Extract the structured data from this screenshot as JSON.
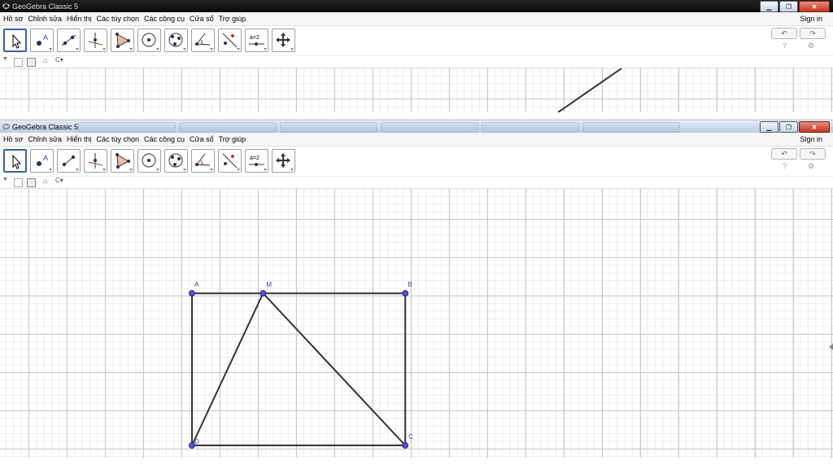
{
  "windows": [
    {
      "title": "GeoGebra Classic 5",
      "menu": [
        "Hồ sơ",
        "Chỉnh sửa",
        "Hiển thị",
        "Các tùy chọn",
        "Các công cụ",
        "Cửa sổ",
        "Trợ giúp"
      ],
      "sign_in": "Sign in"
    },
    {
      "title": "GeoGebra Classic 5",
      "menu": [
        "Hồ sơ",
        "Chỉnh sửa",
        "Hiển thị",
        "Các tùy chọn",
        "Các công cụ",
        "Cửa sổ",
        "Trợ giúp"
      ],
      "sign_in": "Sign in"
    }
  ],
  "window_buttons": {
    "minimize": "▁",
    "maximize": "❐",
    "close": "✕"
  },
  "toolbar": {
    "tools": [
      "move-tool",
      "point-tool",
      "line-tool",
      "perpendicular-line-tool",
      "polygon-tool",
      "circle-tool",
      "conic-tool",
      "angle-tool",
      "reflect-tool",
      "slider-tool",
      "move-graphics-view-tool"
    ],
    "slider_label": "a=2",
    "point_label": "A"
  },
  "undo_label": "↶",
  "redo_label": "↷",
  "help_label": "?",
  "settings_label": "⚙",
  "stylebar": {
    "home": "⌂",
    "caption": "C▾"
  },
  "geometry": {
    "points": [
      {
        "name": "A",
        "x": 0,
        "y": 4
      },
      {
        "name": "M",
        "x": 2,
        "y": 4
      },
      {
        "name": "B",
        "x": 6,
        "y": 4
      },
      {
        "name": "C",
        "x": 6,
        "y": 0
      },
      {
        "name": "D",
        "x": 0,
        "y": 0
      }
    ],
    "segments": [
      [
        "A",
        "B"
      ],
      [
        "B",
        "C"
      ],
      [
        "C",
        "D"
      ],
      [
        "D",
        "A"
      ],
      [
        "D",
        "M"
      ],
      [
        "M",
        "C"
      ]
    ],
    "colors": {
      "point": "#4a52d6",
      "point_stroke": "#1a1a6a",
      "segment": "#333333",
      "label": "#3a43a8"
    }
  }
}
